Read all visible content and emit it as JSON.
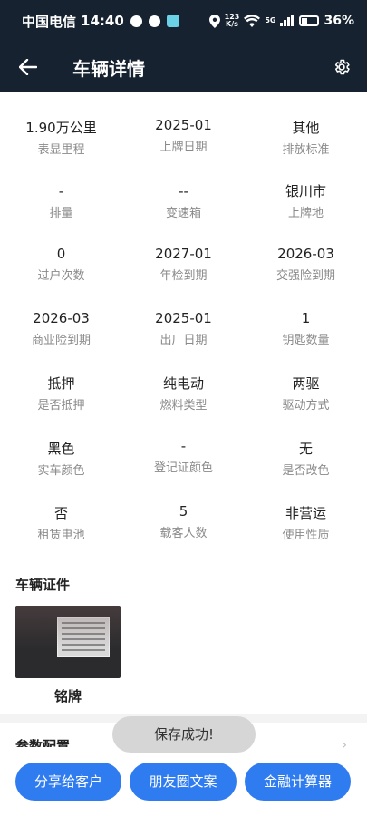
{
  "status_bar": {
    "carrier": "中国电信",
    "time": "14:40",
    "net_speed_top": "123",
    "net_speed_bottom": "K/s",
    "network": "5G",
    "battery": "36%"
  },
  "header": {
    "title": "车辆详情",
    "back_icon": "arrow-left-icon",
    "settings_icon": "gear-icon"
  },
  "specs": [
    {
      "value": "1.90万公里",
      "label": "表显里程"
    },
    {
      "value": "2025-01",
      "label": "上牌日期"
    },
    {
      "value": "其他",
      "label": "排放标准"
    },
    {
      "value": "-",
      "label": "排量"
    },
    {
      "value": "--",
      "label": "变速箱"
    },
    {
      "value": "银川市",
      "label": "上牌地"
    },
    {
      "value": "0",
      "label": "过户次数"
    },
    {
      "value": "2027-01",
      "label": "年检到期"
    },
    {
      "value": "2026-03",
      "label": "交强险到期"
    },
    {
      "value": "2026-03",
      "label": "商业险到期"
    },
    {
      "value": "2025-01",
      "label": "出厂日期"
    },
    {
      "value": "1",
      "label": "钥匙数量"
    },
    {
      "value": "抵押",
      "label": "是否抵押"
    },
    {
      "value": "纯电动",
      "label": "燃料类型"
    },
    {
      "value": "两驱",
      "label": "驱动方式"
    },
    {
      "value": "黑色",
      "label": "实车颜色"
    },
    {
      "value": "-",
      "label": "登记证颜色"
    },
    {
      "value": "无",
      "label": "是否改色"
    },
    {
      "value": "否",
      "label": "租赁电池"
    },
    {
      "value": "5",
      "label": "载客人数"
    },
    {
      "value": "非营运",
      "label": "使用性质"
    }
  ],
  "documents": {
    "section_title": "车辆证件",
    "items": [
      {
        "caption": "铭牌"
      }
    ]
  },
  "next_section_partial": "参数配置",
  "toast": "保存成功!",
  "actions": {
    "share": "分享给客户",
    "moments": "朋友圈文案",
    "finance": "金融计算器"
  },
  "colors": {
    "header_bg": "#172230",
    "primary": "#2f7cf0",
    "label_gray": "#8a8a8a"
  }
}
